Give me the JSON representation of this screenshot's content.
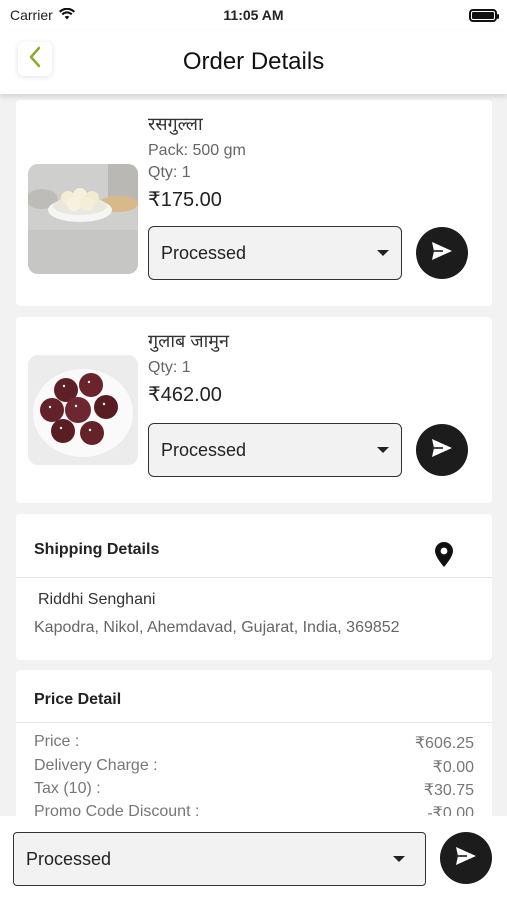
{
  "status_bar": {
    "carrier": "Carrier",
    "time": "11:05 AM"
  },
  "nav": {
    "title": "Order Details"
  },
  "products": [
    {
      "name": "रसगुल्ला",
      "pack_label": "Pack:",
      "pack_value": "500 gm",
      "qty_label": "Qty:",
      "qty_value": "1",
      "price": "₹175.00",
      "status": "Processed"
    },
    {
      "name": "गुलाब जामुन",
      "qty_label": "Qty:",
      "qty_value": "1",
      "price": "₹462.00",
      "status": "Processed"
    }
  ],
  "shipping": {
    "title": "Shipping Details",
    "name": "Riddhi Senghani",
    "address": "Kapodra, Nikol, Ahemdavad, Gujarat, India, 369852"
  },
  "price_detail": {
    "title": "Price Detail",
    "rows": [
      {
        "label": "Price :",
        "value": "₹606.25"
      },
      {
        "label": "Delivery Charge :",
        "value": "₹0.00"
      },
      {
        "label": "Tax (10) :",
        "value": "₹30.75"
      },
      {
        "label": "Promo Code Discount :",
        "value": "-₹0.00"
      }
    ]
  },
  "bottom": {
    "status": "Processed"
  },
  "colors": {
    "accent": "#8bab2a",
    "button_dark": "#1c1c1c"
  }
}
